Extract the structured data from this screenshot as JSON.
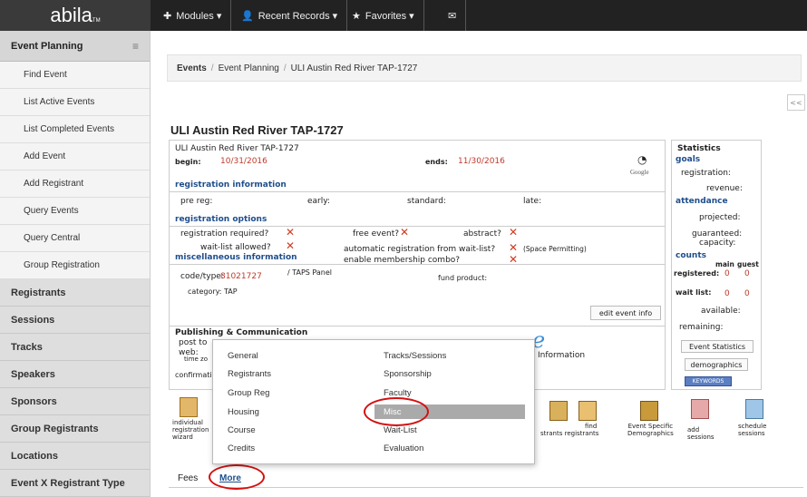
{
  "app": {
    "logo": "abila",
    "logo_tm": "TM"
  },
  "topnav": {
    "modules": "Modules ▾",
    "recent": "Recent Records ▾",
    "favorites": "Favorites ▾"
  },
  "sidebar": {
    "header": "Event Planning",
    "sub_items": [
      "Find Event",
      "List Active Events",
      "List Completed Events",
      "Add Event",
      "Add Registrant",
      "Query Events",
      "Query Central",
      "Group Registration"
    ],
    "sections": [
      "Registrants",
      "Sessions",
      "Tracks",
      "Speakers",
      "Sponsors",
      "Group Registrants",
      "Locations",
      "Event X Registrant Type"
    ]
  },
  "breadcrumb": {
    "root": "Events",
    "mid": "Event Planning",
    "current": "ULI Austin Red River TAP-1727"
  },
  "collapse_label": "<<",
  "page_title": "ULI Austin Red River TAP-1727",
  "event": {
    "name": "ULI Austin Red River TAP-1727",
    "begin_label": "begin:",
    "begin": "10/31/2016",
    "ends_label": "ends:",
    "ends": "11/30/2016",
    "google": "Google",
    "reg_info_header": "registration information",
    "prereg": "pre reg:",
    "early": "early:",
    "standard": "standard:",
    "late": "late:",
    "reg_opts_header": "registration options",
    "reg_required": "registration required?",
    "free_event": "free event?",
    "abstract": "abstract?",
    "waitlist": "wait-list allowed?",
    "auto_reg": "automatic registration from wait-list?",
    "space_permitting": "(Space Permitting)",
    "misc_header": "miscellaneous information",
    "enable_membership": "enable membership combo?",
    "code_type_label": "code/type:",
    "code": "81021727",
    "type": "/ TAPS Panel",
    "fund_product": "fund product:",
    "category": "category:  TAP",
    "edit_btn": "edit event info",
    "publishing_header": "Publishing & Communication",
    "post_to": "post to",
    "web": "web:",
    "time_zone": "time zo",
    "information": "Information",
    "confirmation": "confirmatio"
  },
  "stats": {
    "title": "Statistics",
    "goals": "goals",
    "registration": "registration:",
    "revenue": "revenue:",
    "attendance": "attendance",
    "projected": "projected:",
    "guaranteed": "guaranteed:",
    "capacity": "capacity:",
    "counts": "counts",
    "main": "main",
    "guest": "guest",
    "registered": "registered:",
    "reg_main": "0",
    "reg_guest": "0",
    "waitlist": "wait list:",
    "wl_main": "0",
    "wl_guest": "0",
    "available": "available:",
    "remaining": "remaining:",
    "btn_stats": "Event Statistics",
    "btn_demo": "demographics",
    "btn_keywords": "KEYWORDS"
  },
  "dropdown": {
    "left": [
      "General",
      "Registrants",
      "Group Reg",
      "Housing",
      "Course",
      "Credits"
    ],
    "right": [
      "Tracks/Sessions",
      "Sponsorship",
      "Faculty",
      "Misc",
      "Wait-List",
      "Evaluation"
    ],
    "highlighted": "Misc"
  },
  "icons": {
    "individual": "individual\nregistration\nwizard",
    "find": "find",
    "registrants": "strants registrants",
    "demographics": "Event Specific\nDemographics",
    "add_sessions": "add\nsessions",
    "schedule_sessions": "schedule\nsessions"
  },
  "tabs": {
    "fees": "Fees",
    "more": "More"
  },
  "colors": {
    "topbar": "#222222",
    "accent_red": "#d41010",
    "link_blue": "#1f4e8c"
  }
}
